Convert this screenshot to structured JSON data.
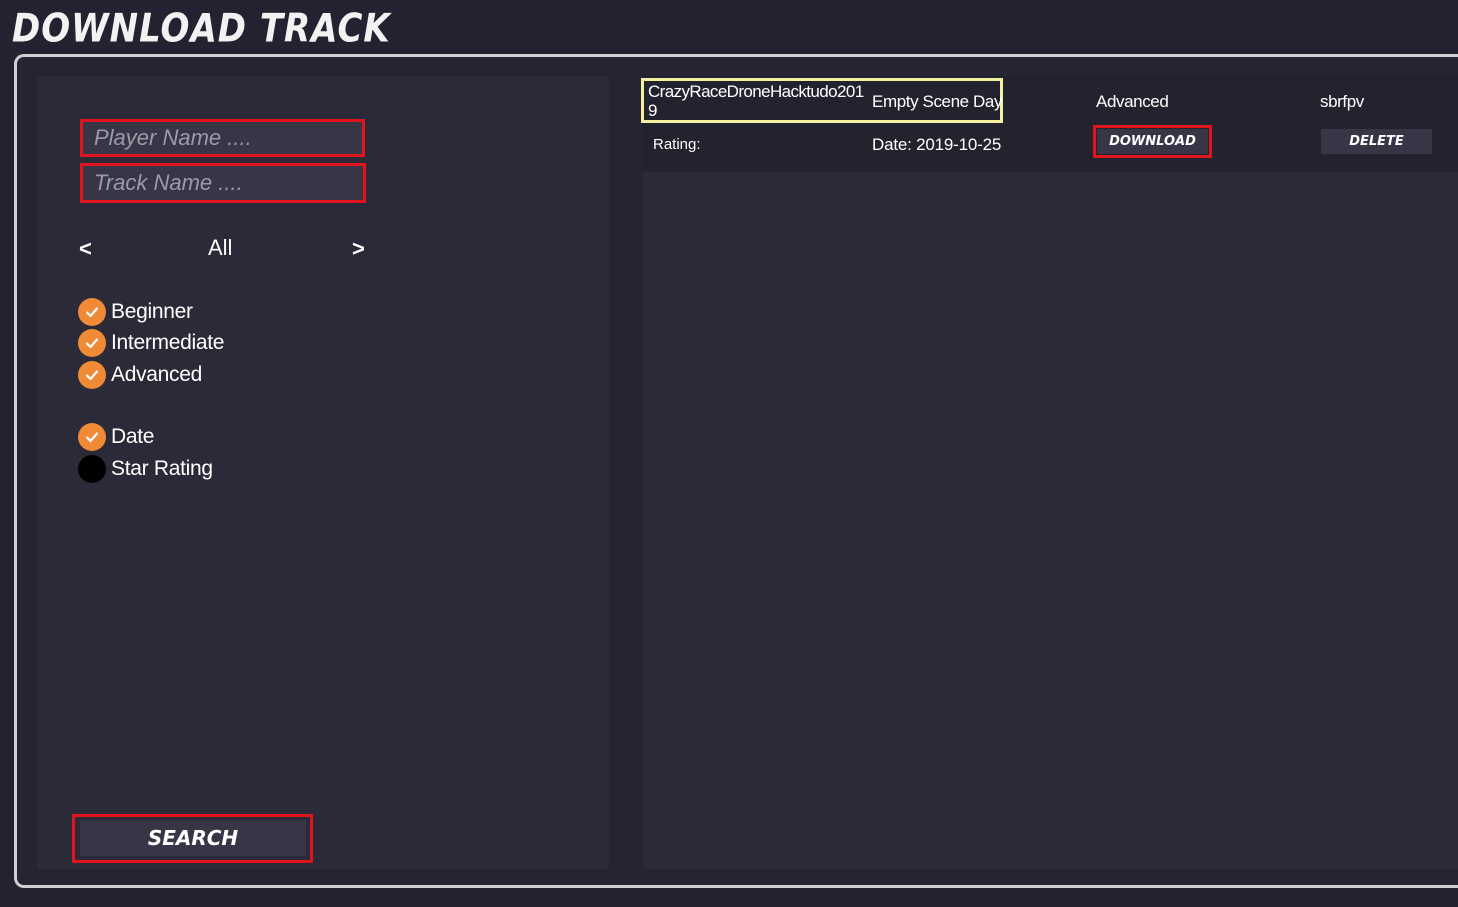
{
  "title": "DOWNLOAD TRACK",
  "filters": {
    "player_placeholder": "Player Name ....",
    "track_placeholder": "Track Name ....",
    "prev_arrow": "<",
    "next_arrow": ">",
    "category": "All",
    "difficulty": [
      {
        "label": "Beginner",
        "checked": true
      },
      {
        "label": "Intermediate",
        "checked": true
      },
      {
        "label": "Advanced",
        "checked": true
      }
    ],
    "sort": [
      {
        "label": "Date",
        "checked": true
      },
      {
        "label": "Star Rating",
        "checked": false
      }
    ],
    "search_label": "SEARCH"
  },
  "results": [
    {
      "track_name_line1": "CrazyRaceDroneHacktudo201",
      "track_name_line2": "9",
      "scene": "Empty Scene Day",
      "difficulty": "Advanced",
      "author": "sbrfpv",
      "rating_label": "Rating:",
      "date": "Date: 2019-10-25",
      "download_label": "DOWNLOAD",
      "delete_label": "DELETE"
    }
  ],
  "colors": {
    "background": "#222230",
    "panel": "#2a2a38",
    "accent_check": "#f08a36",
    "highlight_red": "#e0141c",
    "highlight_yellow": "#f5f0a0"
  }
}
